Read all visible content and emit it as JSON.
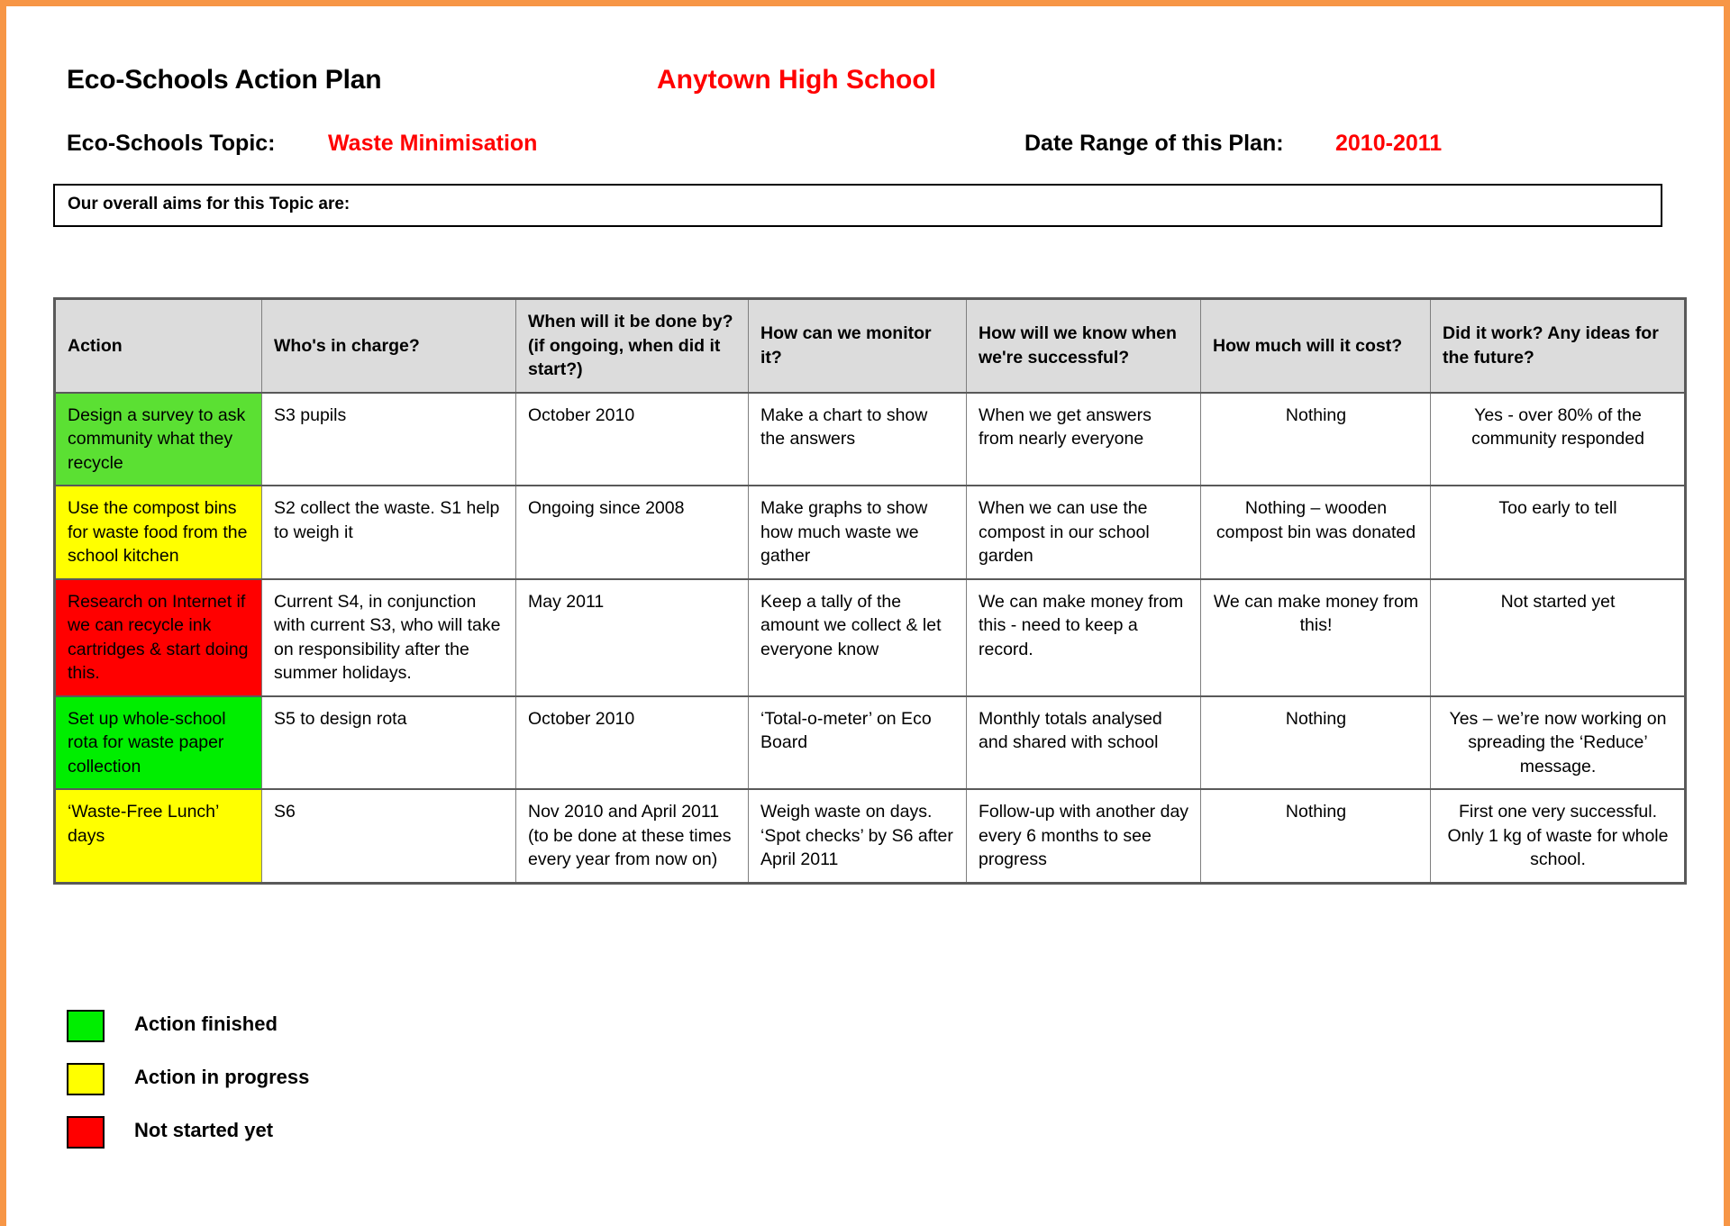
{
  "document": {
    "title": "Eco-Schools Action Plan",
    "school": "Anytown High School",
    "topic_label": "Eco-Schools Topic:",
    "topic_value": "Waste Minimisation",
    "date_range_label": "Date Range of this Plan:",
    "date_range_value": "2010-2011",
    "aims_label": "Our overall aims for this Topic are:",
    "aims_value": ""
  },
  "colors": {
    "accent_border": "#F79646",
    "highlight_red": "#FF0000",
    "header_fill": "#DCDCDC",
    "status_finished": "#00EE00",
    "status_in_progress": "#FFFF00",
    "status_not_started": "#FF0000"
  },
  "table": {
    "headers": [
      "Action",
      "Who's in charge?",
      "When will it be done by? (if ongoing, when did it start?)",
      "How can we monitor it?",
      "How will we know when we're successful?",
      "How much will it cost?",
      "Did it work?\nAny ideas for the future?"
    ],
    "rows": [
      {
        "status": "finished",
        "action": "Design a survey to ask community what they recycle",
        "charge": "S3 pupils",
        "when": "October 2010",
        "monitor": "Make a chart to show the answers",
        "know": "When we get answers from nearly everyone",
        "cost": "Nothing",
        "work": "Yes - over 80% of the community responded"
      },
      {
        "status": "in_progress",
        "action": "Use the compost bins for waste food from the school kitchen",
        "charge": "S2 collect the waste. S1 help to weigh it",
        "when": "Ongoing since 2008",
        "monitor": "Make graphs to show how much waste we gather",
        "know": "When we can use the compost in our school garden",
        "cost": "Nothing – wooden compost bin was donated",
        "work": "Too early to tell"
      },
      {
        "status": "not_started",
        "action": "Research on Internet if we can recycle ink cartridges & start doing this.",
        "charge": "Current S4, in conjunction with current S3, who will take on responsibility after the summer holidays.",
        "when": "May 2011",
        "monitor": "Keep a tally of the amount we collect & let everyone know",
        "know": "We can make money from this - need to keep a record.",
        "cost": "We can make money from this!",
        "work": "Not started yet"
      },
      {
        "status": "finished",
        "action": "Set up whole-school rota for waste paper collection",
        "charge": "S5 to design rota",
        "when": "October 2010",
        "monitor": "‘Total-o-meter’ on Eco Board",
        "know": "Monthly totals analysed and shared with school",
        "cost": "Nothing",
        "work": "Yes – we’re now working on spreading the ‘Reduce’ message."
      },
      {
        "status": "in_progress",
        "action": "‘Waste-Free Lunch’ days",
        "charge": "S6",
        "when": "Nov 2010 and April 2011 (to be done at these times every year from now on)",
        "monitor": "Weigh waste on days. ‘Spot checks’ by S6 after April 2011",
        "know": "Follow-up with another day every 6 months to see progress",
        "cost": "Nothing",
        "work": "First one very successful. Only 1 kg of waste for whole school."
      }
    ]
  },
  "legend": {
    "items": [
      {
        "label": "Action finished",
        "color": "#00EE00"
      },
      {
        "label": "Action in progress",
        "color": "#FFFF00"
      },
      {
        "label": "Not started yet",
        "color": "#FF0000"
      }
    ]
  }
}
